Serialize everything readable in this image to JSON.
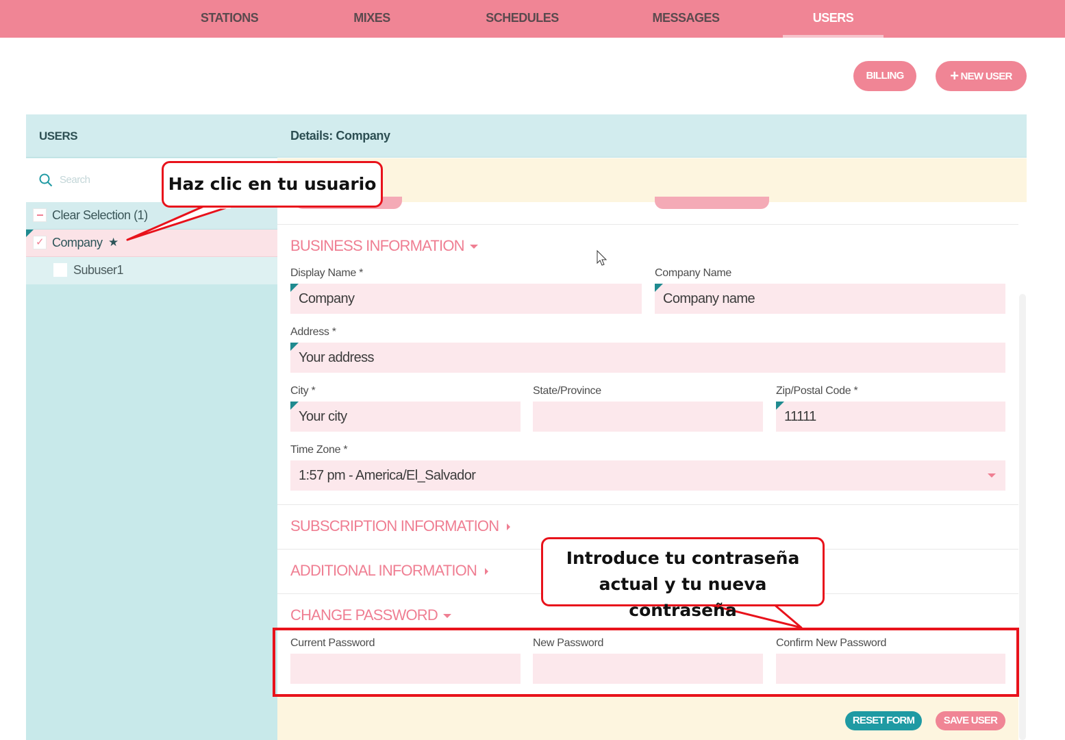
{
  "nav": {
    "tabs": [
      {
        "label": "STATIONS",
        "active": false
      },
      {
        "label": "MIXES",
        "active": false
      },
      {
        "label": "SCHEDULES",
        "active": false
      },
      {
        "label": "MESSAGES",
        "active": false
      },
      {
        "label": "USERS",
        "active": true
      }
    ]
  },
  "actions": {
    "billing_label": "BILLING",
    "new_user_label": "NEW USER"
  },
  "users_panel": {
    "title": "USERS",
    "search_placeholder": "Search",
    "clear_selection_label": "Clear Selection (1)",
    "items": [
      {
        "label": "Company",
        "selected": true,
        "starred": true
      },
      {
        "label": "Subuser1",
        "selected": false,
        "starred": false
      }
    ]
  },
  "details": {
    "title": "Details: Company",
    "business_section": {
      "title": "BUSINESS INFORMATION",
      "display_name": {
        "label": "Display Name *",
        "value": "Company"
      },
      "company_name": {
        "label": "Company Name",
        "value": "Company name"
      },
      "address": {
        "label": "Address *",
        "value": "Your address"
      },
      "city": {
        "label": "City *",
        "value": "Your city"
      },
      "state": {
        "label": "State/Province",
        "value": ""
      },
      "zip": {
        "label": "Zip/Postal Code *",
        "value": "11111"
      },
      "timezone": {
        "label": "Time Zone *",
        "value": "1:57 pm - America/El_Salvador"
      }
    },
    "subscription_section_title": "SUBSCRIPTION INFORMATION",
    "additional_section_title": "ADDITIONAL INFORMATION",
    "password_section": {
      "title": "CHANGE PASSWORD",
      "current_label": "Current Password",
      "new_label": "New Password",
      "confirm_label": "Confirm New Password"
    },
    "reset_label": "RESET FORM",
    "save_label": "SAVE USER"
  },
  "annotations": {
    "click_user": "Haz clic en tu usuario",
    "enter_password_line1": "Introduce tu contraseña",
    "enter_password_line2": "actual y tu nueva contraseña"
  },
  "colors": {
    "brand_pink": "#f08595",
    "teal": "#1f9aa3",
    "panel_header": "#d2ecee",
    "annotation_red": "#e8121b"
  }
}
